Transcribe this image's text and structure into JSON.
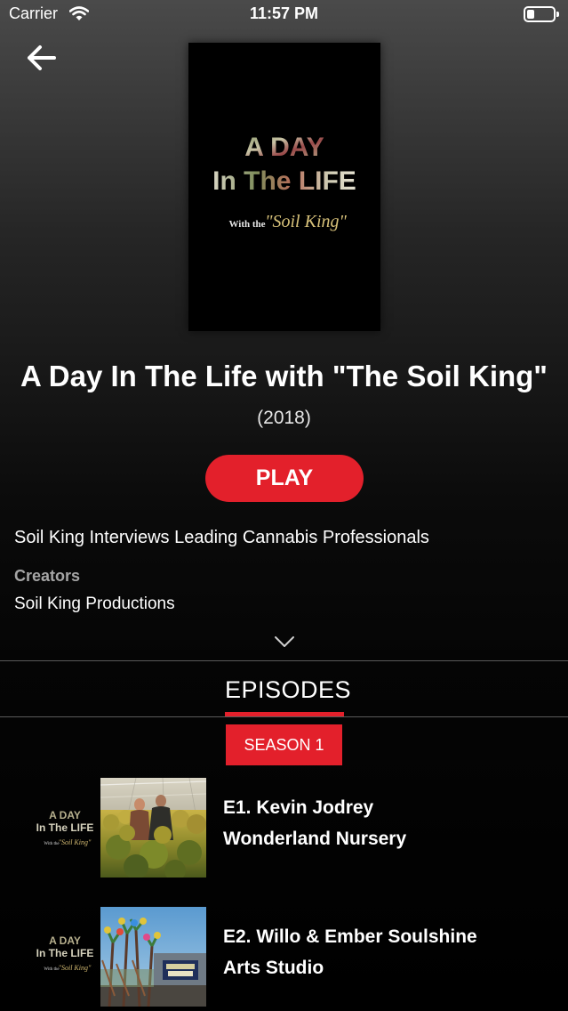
{
  "status_bar": {
    "carrier": "Carrier",
    "time": "11:57 PM"
  },
  "poster": {
    "line1": "A DAY",
    "line2": "In The LIFE",
    "with": "With the",
    "soil_king": "\"Soil King\""
  },
  "show": {
    "title": "A Day In The Life with \"The Soil King\"",
    "year": "(2018)",
    "play_label": "PLAY",
    "description": "Soil King Interviews Leading Cannabis Professionals",
    "creators_label": "Creators",
    "creators_value": "Soil King Productions"
  },
  "tabs": {
    "episodes_label": "EPISODES"
  },
  "season": {
    "selected_label": "SEASON 1"
  },
  "episodes": [
    {
      "title": "E1. Kevin Jodrey",
      "subtitle": "Wonderland Nursery"
    },
    {
      "title": "E2. Willo & Ember Soulshine",
      "subtitle": "Arts Studio"
    }
  ],
  "episode_logo": {
    "line1": "A DAY",
    "line2": "In The LIFE",
    "with": "With the",
    "soil_king": "\"Soil King\""
  },
  "colors": {
    "accent": "#e3202b",
    "background": "#000000",
    "muted_text": "#a5a5a5"
  },
  "icons": {
    "back": "arrow-left-icon",
    "wifi": "wifi-icon",
    "battery": "battery-icon",
    "expand": "chevron-down-icon"
  }
}
